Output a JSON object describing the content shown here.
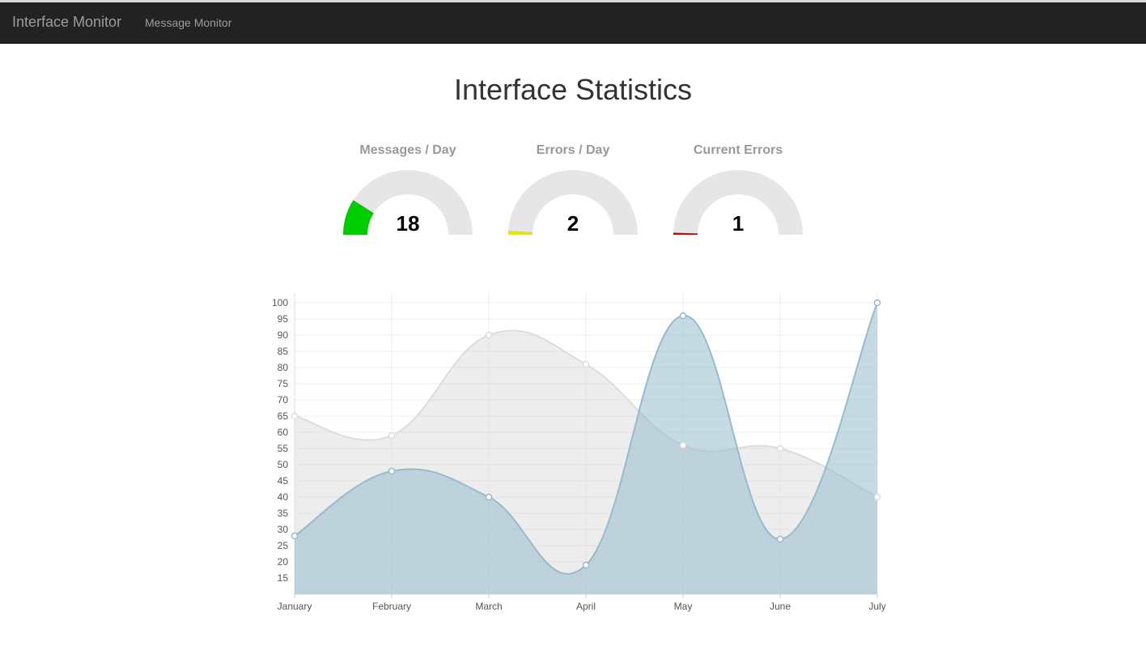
{
  "navbar": {
    "brand": "Interface Monitor",
    "links": [
      "Message Monitor"
    ]
  },
  "page": {
    "title": "Interface Statistics"
  },
  "gauges": [
    {
      "title": "Messages / Day",
      "value": "18",
      "fraction": 0.18,
      "color": "#00cc00"
    },
    {
      "title": "Errors / Day",
      "value": "2",
      "fraction": 0.02,
      "color": "#e6e600"
    },
    {
      "title": "Current Errors",
      "value": "1",
      "fraction": 0.01,
      "color": "#cc0000"
    }
  ],
  "colors": {
    "navbar_bg": "#222222",
    "gauge_track": "#e6e6e6",
    "series_gray_fill": "rgba(220,220,220,0.5)",
    "series_gray_stroke": "#dcdcdc",
    "series_blue_fill": "rgba(151,187,205,0.55)",
    "series_blue_stroke": "#97bbcd"
  },
  "chart_data": {
    "type": "area",
    "categories": [
      "January",
      "February",
      "March",
      "April",
      "May",
      "June",
      "July"
    ],
    "ylim": [
      10,
      100
    ],
    "yticks": [
      15,
      20,
      25,
      30,
      35,
      40,
      45,
      50,
      55,
      60,
      65,
      70,
      75,
      80,
      85,
      90,
      95,
      100
    ],
    "grid": true,
    "series": [
      {
        "values": [
          65,
          59,
          90,
          81,
          56,
          55,
          40
        ],
        "color": "#dcdcdc"
      },
      {
        "values": [
          28,
          48,
          40,
          19,
          96,
          27,
          100
        ],
        "color": "#97bbcd"
      }
    ]
  }
}
